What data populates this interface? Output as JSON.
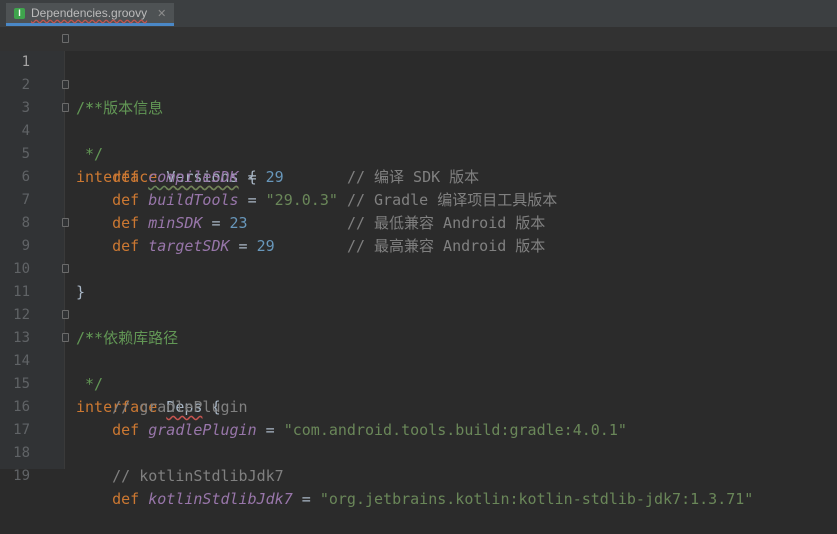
{
  "tab": {
    "icon_letter": "I",
    "file_name": "Dependencies.groovy",
    "close_glyph": "✕"
  },
  "code": {
    "l1": "1",
    "l2": "2",
    "l3": "3",
    "l4": "4",
    "l5": "5",
    "l6": "6",
    "l7": "7",
    "l8": "8",
    "l9": "9",
    "l10": "10",
    "l11": "11",
    "l12": "12",
    "l13": "13",
    "l14": "14",
    "l15": "15",
    "l16": "16",
    "l17": "17",
    "l18": "18",
    "l19": "19",
    "doc_open": "/**",
    "doc_versions": " * 版本信息",
    "doc_close": " */",
    "kw_interface": "interface",
    "versions_name": "Versions",
    "brace_open": " {",
    "brace_close": "}",
    "kw_def": "def",
    "compileSDK": "compileSDK",
    "compileSDK_val": "29",
    "compileSDK_cm": "// 编译 SDK 版本",
    "buildTools": "buildTools",
    "buildTools_val": "\"29.0.3\"",
    "buildTools_cm": "// Gradle 编译项目工具版本",
    "minSDK": "minSDK",
    "minSDK_val": "23",
    "minSDK_cm": "// 最低兼容 Android 版本",
    "targetSDK": "targetSDK",
    "targetSDK_val": "29",
    "targetSDK_cm": "// 最高兼容 Android 版本",
    "doc_deps": " * 依赖库路径",
    "deps_name": "Deps",
    "cm_gradlePlugin": "// gradlePlugin",
    "gradlePlugin": "gradlePlugin",
    "gradlePlugin_val": "\"com.android.tools.build:gradle:4.0.1\"",
    "cm_kotlin": "// kotlinStdlibJdk7",
    "kotlinStdlibJdk7": "kotlinStdlibJdk7",
    "kotlin_val": "\"org.jetbrains.kotlin:kotlin-stdlib-jdk7:1.3.71\""
  }
}
